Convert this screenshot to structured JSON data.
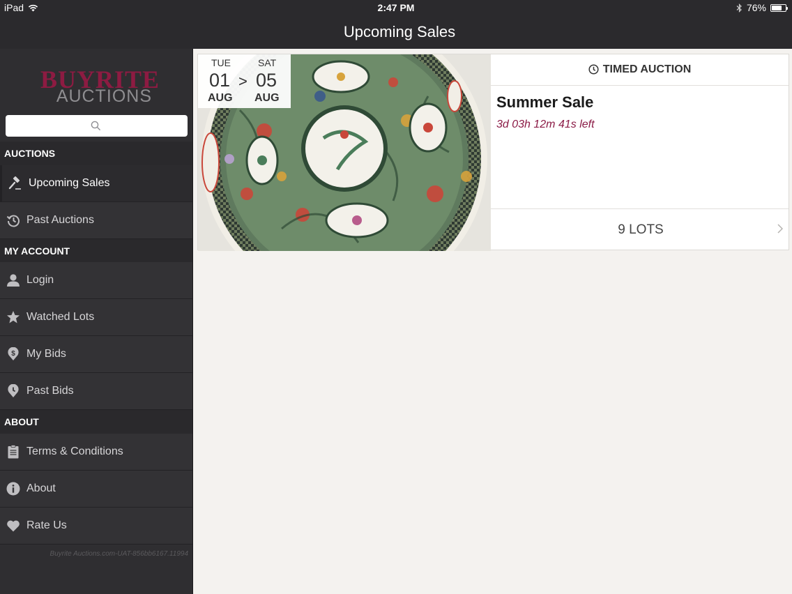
{
  "status_bar": {
    "device": "iPad",
    "time": "2:47 PM",
    "battery": "76%",
    "battery_level": 0.76
  },
  "nav": {
    "title": "Upcoming Sales"
  },
  "sidebar": {
    "logo": {
      "line1": "BUYRITE",
      "line2": "AUCTIONS"
    },
    "search_placeholder": "",
    "sections": {
      "auctions": "AUCTIONS",
      "my_account": "MY ACCOUNT",
      "about": "ABOUT"
    },
    "items": {
      "upcoming_sales": "Upcoming Sales",
      "past_auctions": "Past Auctions",
      "login": "Login",
      "watched_lots": "Watched Lots",
      "my_bids": "My Bids",
      "past_bids": "Past Bids",
      "terms": "Terms & Conditions",
      "about": "About",
      "rate_us": "Rate Us"
    },
    "version": "Buyrite Auctions.com-UAT-856bb6167.11994"
  },
  "sale": {
    "start_day": "TUE",
    "start_date": "01",
    "start_month": "AUG",
    "arrow": ">",
    "end_day": "SAT",
    "end_date": "05",
    "end_month": "AUG",
    "type": "TIMED AUCTION",
    "name": "Summer Sale",
    "time_left": "3d 03h 12m 41s left",
    "lots": "9 LOTS"
  },
  "colors": {
    "brand": "#8d1b42",
    "sidebar": "#2f2e31",
    "countdown": "#8b1b46"
  }
}
